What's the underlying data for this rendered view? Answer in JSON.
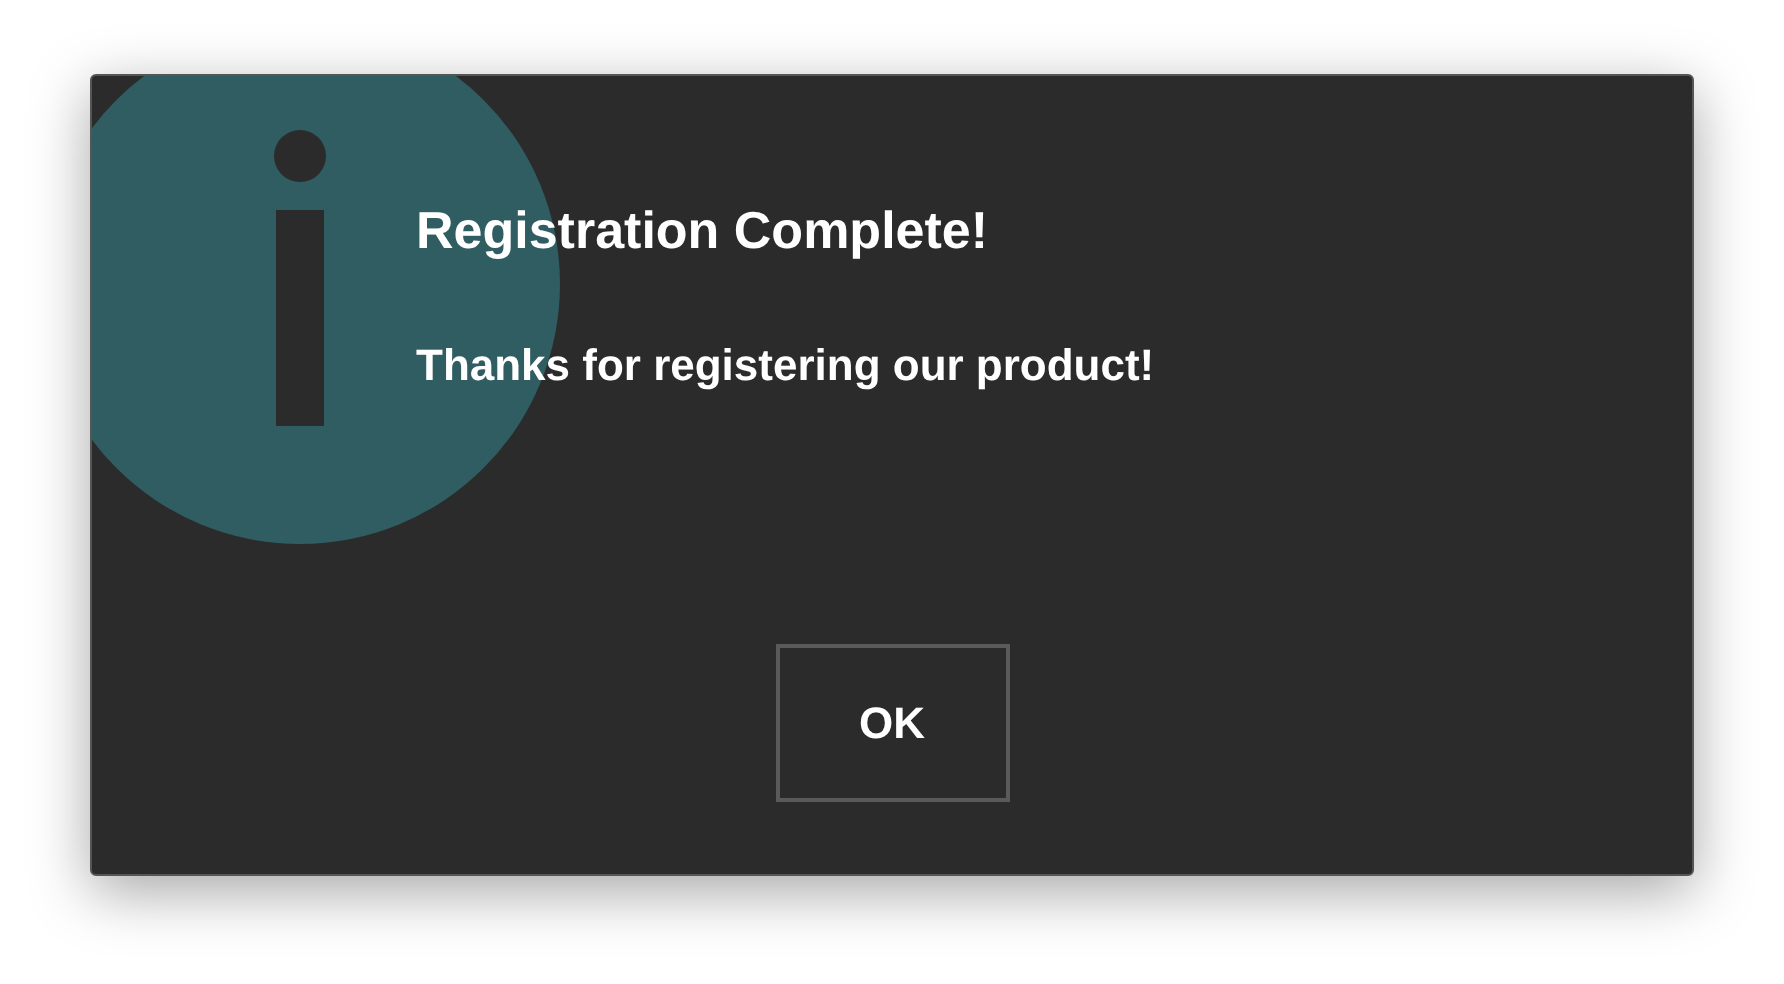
{
  "dialog": {
    "title": "Registration Complete!",
    "message": "Thanks for registering our product!",
    "buttons": [
      "OK"
    ]
  }
}
